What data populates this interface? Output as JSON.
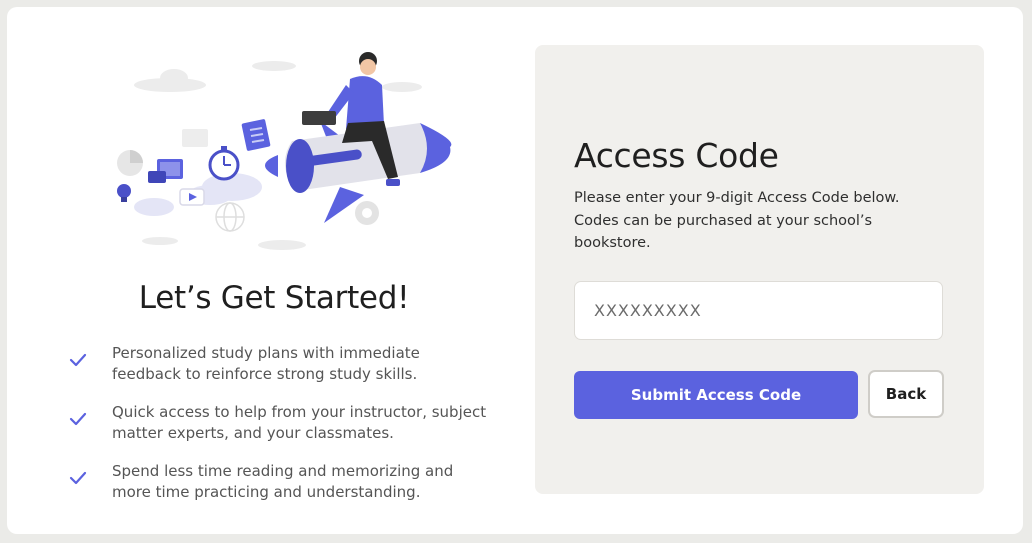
{
  "left": {
    "heading": "Let’s Get Started!",
    "features": [
      {
        "icon": "check-icon",
        "text": "Personalized study plans with immediate feedback to reinforce strong study skills."
      },
      {
        "icon": "check-icon",
        "text": "Quick access to help from your instructor, subject matter experts, and your classmates."
      },
      {
        "icon": "check-icon",
        "text": "Spend less time reading and memorizing and more time practicing and understanding."
      }
    ],
    "illustration": "person-riding-rocket-illustration"
  },
  "access_panel": {
    "title": "Access Code",
    "description": "Please enter your 9-digit Access Code below. Codes can be purchased at your school’s bookstore.",
    "input": {
      "value": "",
      "placeholder": "XXXXXXXXX"
    },
    "submit_label": "Submit Access Code",
    "back_label": "Back"
  },
  "colors": {
    "accent": "#5b62df",
    "panel_bg": "#f1f0ed",
    "page_bg": "#ebebe8"
  }
}
